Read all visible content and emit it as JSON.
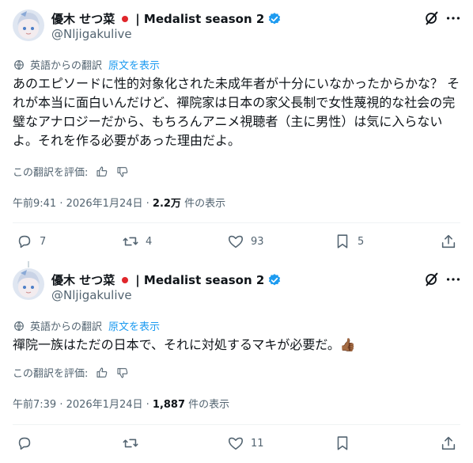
{
  "tweets": [
    {
      "display_name": "優木 せつ菜",
      "name_suffix": "| Medalist season 2",
      "handle": "@Nljigakulive",
      "translated_label": "英語からの翻訳",
      "show_original": "原文を表示",
      "text": "あのエピソードに性的対象化された未成年者が十分にいなかったからかな？ それが本当に面白いんだけど、禪院家は日本の家父長制で女性蔑視的な社会の完璧なアナロジーだから、もちろんアニメ視聴者（主に男性）は気に入らないよ。それを作る必要があった理由だよ。",
      "rate_label": "この翻訳を評価:",
      "time": "午前9:41 · 2026年1月24日 ·",
      "views": "2.2万",
      "views_suffix": "件の表示",
      "replies": "7",
      "retweets": "4",
      "likes": "93",
      "bookmarks": "5"
    },
    {
      "display_name": "優木 せつ菜",
      "name_suffix": "| Medalist season 2",
      "handle": "@Nljigakulive",
      "translated_label": "英語からの翻訳",
      "show_original": "原文を表示",
      "text": "禪院一族はただの日本で、それに対処するマキが必要だ。👍🏾",
      "rate_label": "この翻訳を評価:",
      "time": "午前7:39 · 2026年1月24日 ·",
      "views": "1,887",
      "views_suffix": "件の表示",
      "replies": "",
      "retweets": "",
      "likes": "11",
      "bookmarks": ""
    }
  ],
  "icons": {
    "grok": "grok-icon",
    "more": "more-icon",
    "reply": "reply-icon",
    "retweet": "retweet-icon",
    "like": "heart-icon",
    "bookmark": "bookmark-icon",
    "share": "share-icon",
    "translate": "translate-icon",
    "thumb_up": "thumb-up-icon",
    "thumb_down": "thumb-down-icon"
  },
  "colors": {
    "text": "#0f1419",
    "secondary": "#536471",
    "link": "#1d9bf0",
    "verified": "#1d9bf0",
    "flag_red": "#e0262b"
  }
}
